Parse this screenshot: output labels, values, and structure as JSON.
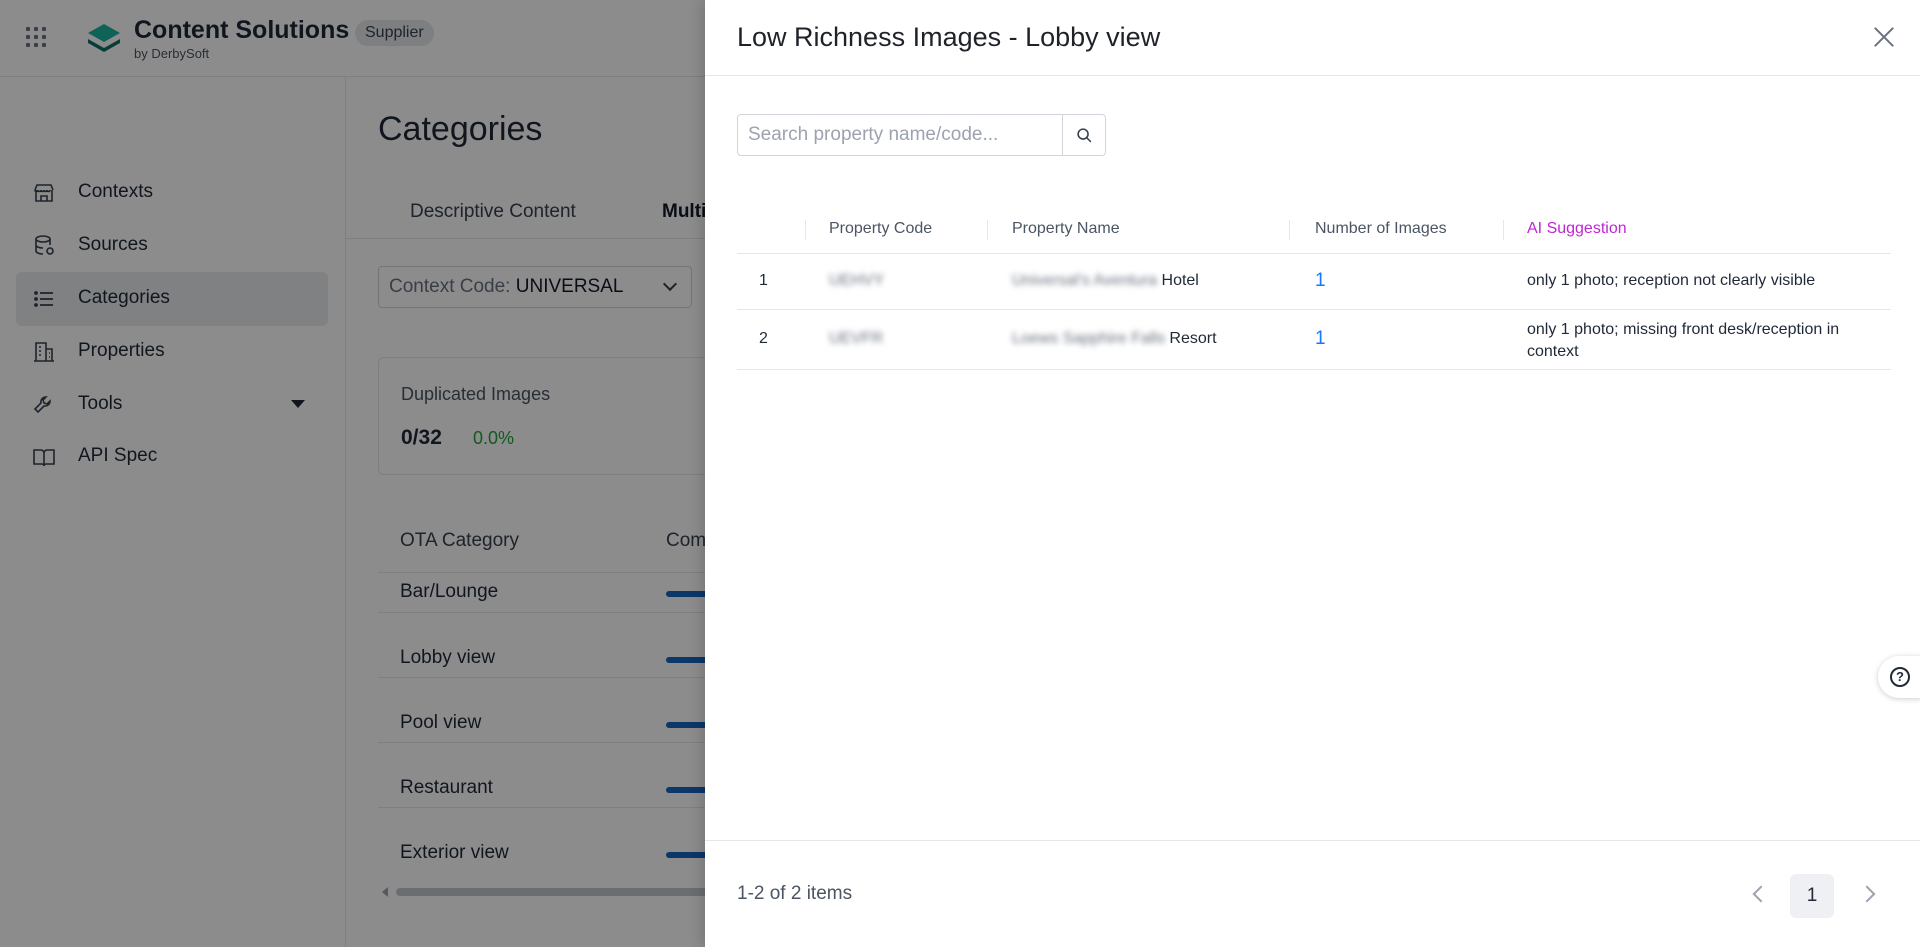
{
  "header": {
    "brand": "Content Solutions",
    "brand_sub": "by DerbySoft",
    "badge": "Supplier"
  },
  "sidebar": {
    "items": [
      {
        "label": "Contexts",
        "icon": "store-icon",
        "active": false
      },
      {
        "label": "Sources",
        "icon": "database-icon",
        "active": false
      },
      {
        "label": "Categories",
        "icon": "list-icon",
        "active": true
      },
      {
        "label": "Properties",
        "icon": "building-icon",
        "active": false
      },
      {
        "label": "Tools",
        "icon": "wrench-icon",
        "active": false
      },
      {
        "label": "API Spec",
        "icon": "book-icon",
        "active": false
      }
    ]
  },
  "main": {
    "title": "Categories",
    "tabs": [
      "Descriptive Content",
      "Multi"
    ],
    "context_label": "Context Code:",
    "context_value": "UNIVERSAL",
    "duplicated": {
      "title": "Duplicated Images",
      "value": "0/32",
      "pct": "0.0%"
    },
    "ota_header": [
      "OTA Category",
      "Com"
    ],
    "categories": [
      "Bar/Lounge",
      "Lobby view",
      "Pool view",
      "Restaurant",
      "Exterior view"
    ]
  },
  "drawer": {
    "title": "Low Richness Images - Lobby view",
    "search_placeholder": "Search property name/code...",
    "columns": [
      "Property Code",
      "Property Name",
      "Number of Images",
      "AI Suggestion"
    ],
    "rows": [
      {
        "index": "1",
        "code": "UEHVY",
        "name_blurred": "Universal's Aventura",
        "name_visible": " Hotel",
        "images": "1",
        "suggestion": "only 1 photo; reception not clearly visible"
      },
      {
        "index": "2",
        "code": "UEVFR",
        "name_blurred": "Loews Sapphire Falls",
        "name_visible": " Resort",
        "images": "1",
        "suggestion": "only 1 photo; missing front desk/reception in context"
      }
    ],
    "pagination": {
      "summary": "1-2 of 2 items",
      "current": "1"
    }
  },
  "colors": {
    "accent": "#1677ff",
    "ai": "#c026d3",
    "progress": "#1565c0",
    "positive": "#22a33c"
  }
}
